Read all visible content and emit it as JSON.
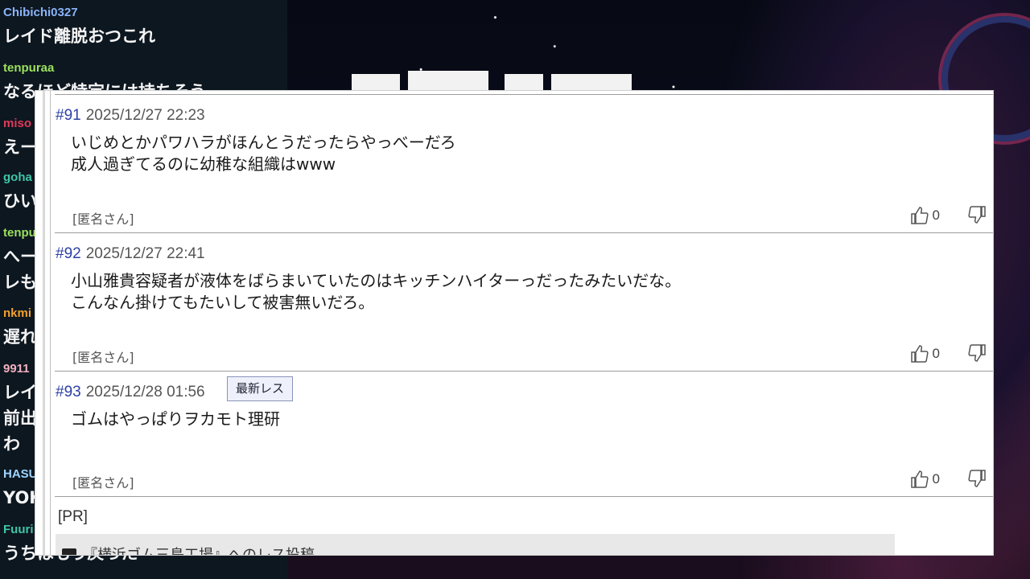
{
  "chat": {
    "messages": [
      {
        "user": "Chibichi0327",
        "user_color": "#8ab4f8",
        "text": "レイド離脱おつこれ"
      },
      {
        "user": "tenpuraa",
        "user_color": "#9be15d",
        "text": "なるほど特定には持ちそう"
      },
      {
        "user": "miso",
        "user_color": "#e23b5a",
        "text": "えー"
      },
      {
        "user": "goha",
        "user_color": "#3fc6a8",
        "text": "ひい"
      },
      {
        "user": "tenpu",
        "user_color": "#9be15d",
        "text": "へー"
      },
      {
        "user": "",
        "user_color": "#9be15d",
        "text": "レも"
      },
      {
        "user": "nkmi",
        "user_color": "#f0a030",
        "text": "遅れ"
      },
      {
        "user": "9911",
        "user_color": "#f4b0c0",
        "text": "レイ"
      },
      {
        "user": "",
        "user_color": "#f4b0c0",
        "text": "前出"
      },
      {
        "user": "",
        "user_color": "#f4b0c0",
        "text": "わ"
      },
      {
        "user": "HASU",
        "user_color": "#9fd3ff",
        "text": "YOK"
      },
      {
        "user": "Fuuri",
        "user_color": "#3fc6a8",
        "text": "うちはもう戻った"
      }
    ]
  },
  "thread": {
    "posts": [
      {
        "num": "#91",
        "date": "2025/12/27 22:23",
        "badge": "",
        "lines": [
          "いじめとかパワハラがほんとうだったらやっべーだろ",
          "成人過ぎてるのに幼稚な組織はwww"
        ],
        "author": "[匿名さん]",
        "likes": "0"
      },
      {
        "num": "#92",
        "date": "2025/12/27 22:41",
        "badge": "",
        "lines": [
          "小山雅貴容疑者が液体をばらまいていたのはキッチンハイターっだったみたいだな。",
          "こんなん掛けてもたいして被害無いだろ。"
        ],
        "author": "[匿名さん]",
        "likes": "0"
      },
      {
        "num": "#93",
        "date": "2025/12/28 01:56",
        "badge": "最新レス",
        "lines": [
          "ゴムはやっぱりヲカモト理研"
        ],
        "author": "[匿名さん]",
        "likes": "0"
      }
    ],
    "pr_label": "[PR]",
    "post_form_text": "『横浜ゴム三島工場』へのレス投稿"
  },
  "icons": {
    "like": "thumbs-up-icon",
    "dislike": "thumbs-down-icon"
  },
  "colors": {
    "post_number": "#2c3fa6",
    "badge_bg": "#eef1fb",
    "chat_bg": "#0d1720"
  }
}
